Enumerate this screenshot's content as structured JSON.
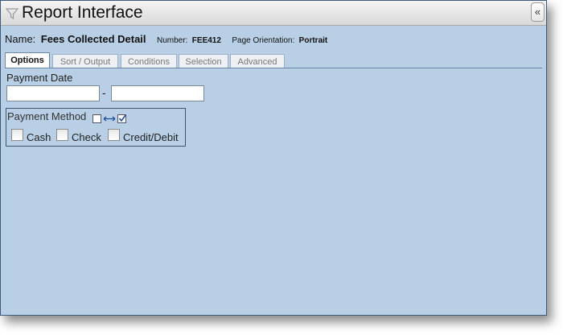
{
  "window": {
    "title": "Report Interface",
    "collapse_glyph": "«"
  },
  "report": {
    "name_label": "Name:",
    "name_value": "Fees Collected Detail",
    "number_label": "Number:",
    "number_value": "FEE412",
    "orientation_label": "Page Orientation:",
    "orientation_value": "Portrait"
  },
  "tabs": [
    {
      "label": "Options",
      "active": true
    },
    {
      "label": "Sort / Output",
      "active": false
    },
    {
      "label": "Conditions",
      "active": false
    },
    {
      "label": "Selection",
      "active": false
    },
    {
      "label": "Advanced",
      "active": false
    }
  ],
  "options": {
    "payment_date_label": "Payment Date",
    "date_from_value": "",
    "date_to_value": "",
    "date_separator": "-",
    "payment_method": {
      "label": "Payment Method",
      "options": [
        {
          "label": "Cash",
          "checked": false
        },
        {
          "label": "Check",
          "checked": false
        },
        {
          "label": "Credit/Debit",
          "checked": false
        }
      ]
    }
  },
  "icons": {
    "title": "funnel-icon",
    "collapse": "double-chevron-left-icon",
    "calendar": "calendar-icon",
    "toggle_all": "select-all-toggle-icon"
  },
  "colors": {
    "panel_background": "#b8cfe6",
    "border": "#3d5a7d",
    "titlebar": "#e6e6e6"
  }
}
